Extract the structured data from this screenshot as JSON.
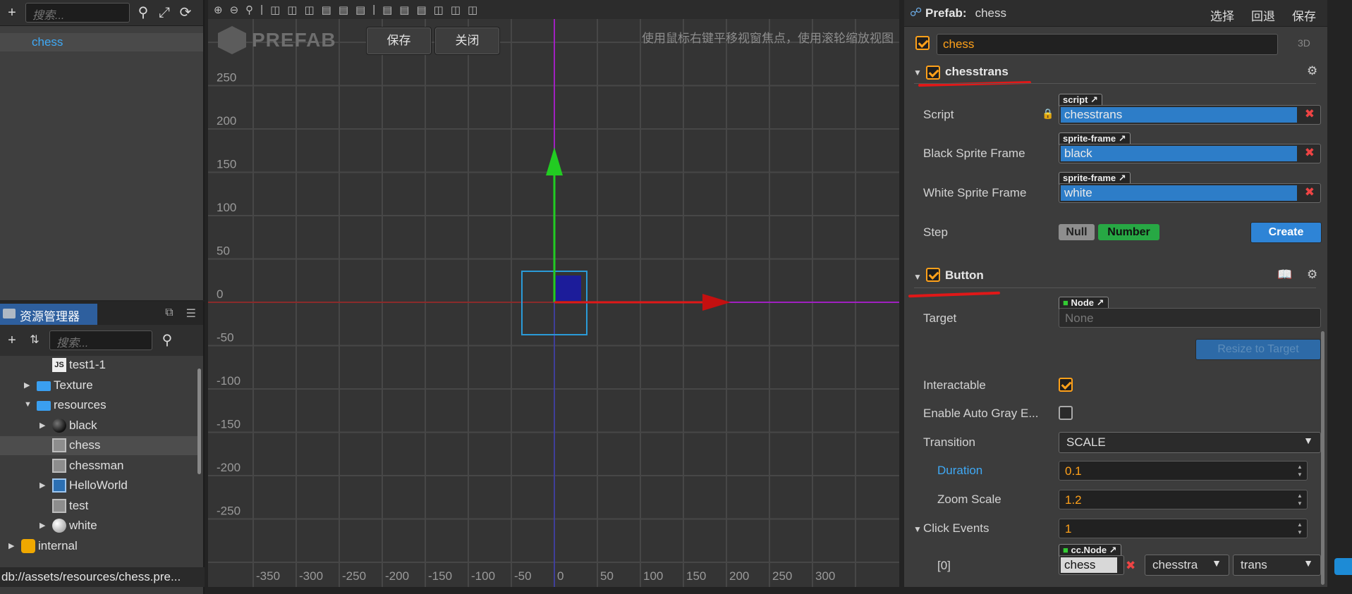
{
  "hierarchy": {
    "search_placeholder": "搜索...",
    "items": [
      {
        "label": "chess"
      }
    ]
  },
  "assets": {
    "tab_title": "资源管理器",
    "search_placeholder": "搜索...",
    "tree": [
      {
        "label": "test1-1",
        "icon": "js-file-icon",
        "indent": 2
      },
      {
        "label": "Texture",
        "icon": "folder-icon",
        "indent": 1,
        "arrow": "▶"
      },
      {
        "label": "resources",
        "icon": "folder-icon",
        "indent": 1,
        "arrow": "▼"
      },
      {
        "label": "black",
        "icon": "sprite-ball-icon",
        "indent": 2,
        "arrow": "▶"
      },
      {
        "label": "chess",
        "icon": "prefab-icon",
        "indent": 2,
        "selected": true
      },
      {
        "label": "chessman",
        "icon": "prefab-icon",
        "indent": 2
      },
      {
        "label": "HelloWorld",
        "icon": "scene-icon",
        "indent": 2,
        "arrow": "▶"
      },
      {
        "label": "test",
        "icon": "prefab-icon",
        "indent": 2
      },
      {
        "label": "white",
        "icon": "sprite-ball-icon",
        "indent": 2,
        "arrow": "▶"
      },
      {
        "label": "internal",
        "icon": "internal-db-icon",
        "indent": 0,
        "arrow": "▶"
      }
    ],
    "status_path": "db://assets/resources/chess.pre..."
  },
  "scene": {
    "logo_text": "PREFAB",
    "save_label": "保存",
    "close_label": "关闭",
    "hint": "使用鼠标右键平移视窗焦点，使用滚轮缩放视图",
    "y_ticks": [
      "250",
      "200",
      "150",
      "100",
      "50",
      "0",
      "-50",
      "-100",
      "-150",
      "-200",
      "-250"
    ],
    "x_ticks": [
      "-350",
      "-300",
      "-250",
      "-200",
      "-150",
      "-100",
      "-50",
      "0",
      "50",
      "100",
      "150",
      "200",
      "250",
      "300"
    ]
  },
  "inspector": {
    "prefab_label": "Prefab:",
    "prefab_name": "chess",
    "actions": [
      "选择",
      "回退",
      "保存"
    ],
    "node_name": "chess",
    "mode_3d": "3D",
    "comp1": {
      "title": "chesstrans",
      "script_label": "Script",
      "script_tag": "script",
      "script_value": "chesstrans",
      "black_label": "Black Sprite Frame",
      "black_tag": "sprite-frame",
      "black_value": "black",
      "white_label": "White Sprite Frame",
      "white_tag": "sprite-frame",
      "white_value": "white",
      "step_label": "Step",
      "step_null": "Null",
      "step_number": "Number",
      "create_label": "Create"
    },
    "comp2": {
      "title": "Button",
      "target_label": "Target",
      "target_tag": "Node",
      "target_value": "None",
      "resize_label": "Resize to Target",
      "interactable_label": "Interactable",
      "autogray_label": "Enable Auto Gray E...",
      "transition_label": "Transition",
      "transition_value": "SCALE",
      "duration_label": "Duration",
      "duration_value": "0.1",
      "zoom_label": "Zoom Scale",
      "zoom_value": "1.2",
      "click_label": "Click Events",
      "click_value": "1",
      "event_index": "[0]",
      "event_tag": "cc.Node",
      "event_node": "chess",
      "event_component": "chesstra",
      "event_handler": "trans"
    }
  },
  "colors": {
    "accent_orange": "#ffa11a",
    "selection_blue": "#3fa9f5",
    "asset_blue": "#2d7dc8",
    "axis_x": "#e01818",
    "axis_y": "#22cc22",
    "grid_line_purple": "#a020c0"
  }
}
